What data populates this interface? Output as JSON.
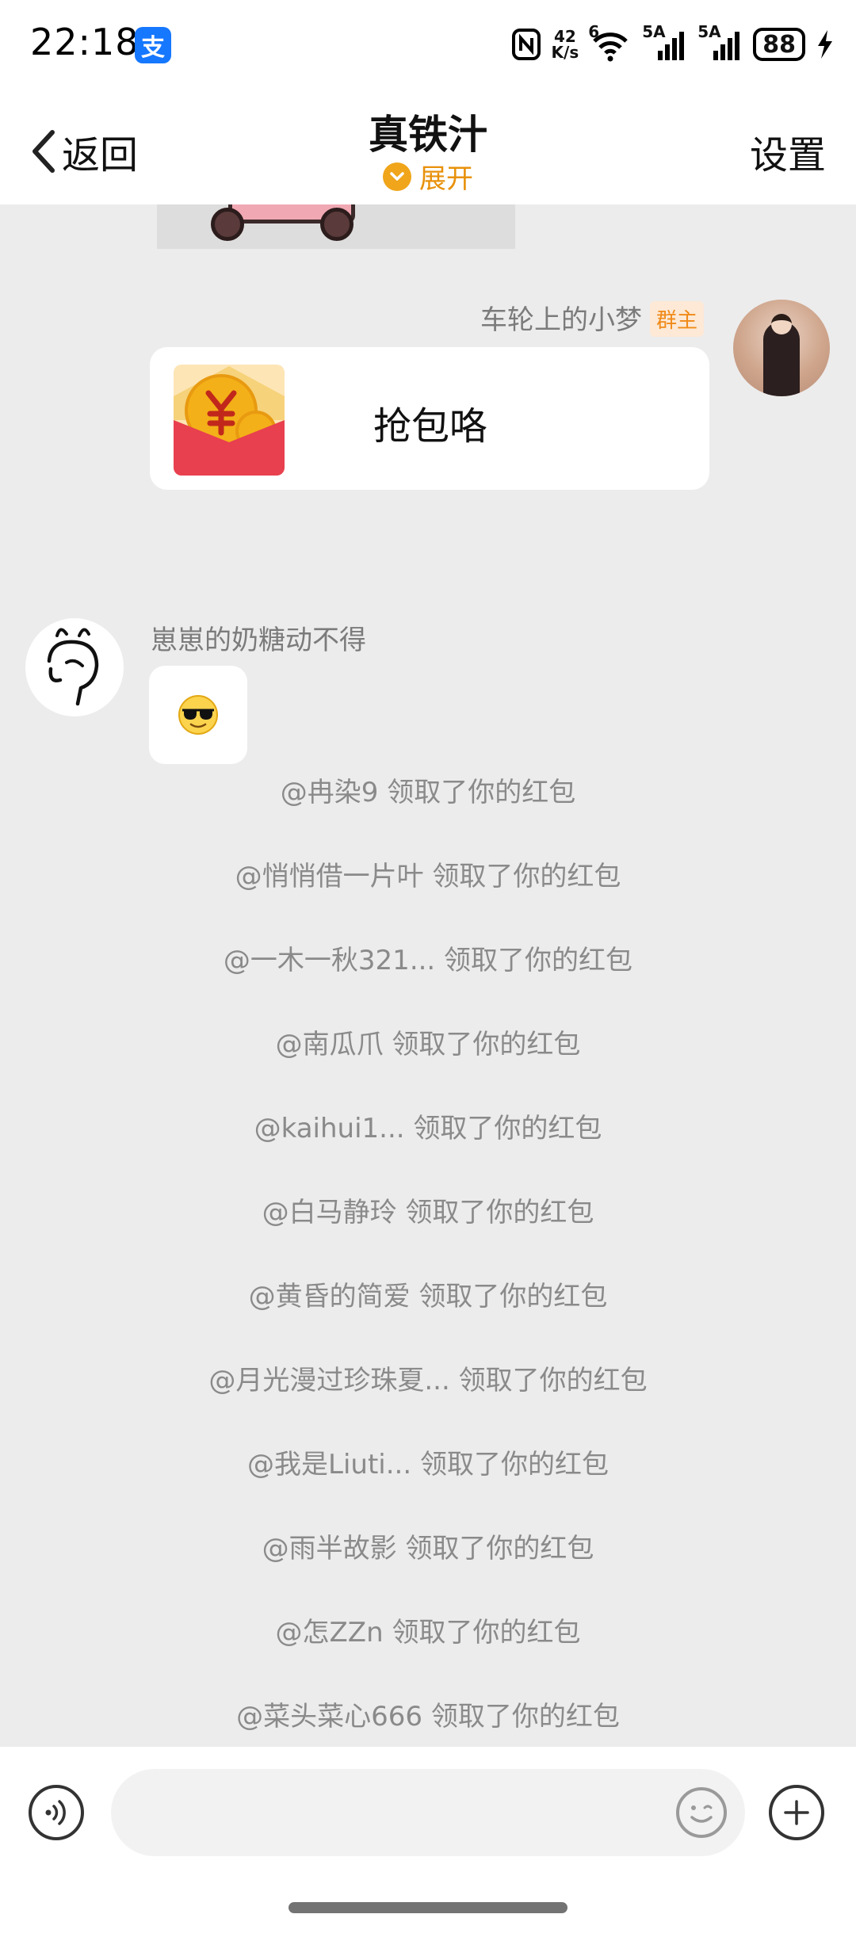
{
  "status_bar": {
    "time": "22:18",
    "app_badge": "支",
    "net_speed_value": "42",
    "net_speed_unit": "K/s",
    "wifi_label": "6",
    "signal1_label": "5A",
    "signal2_label": "5A",
    "battery": "88"
  },
  "nav": {
    "back_label": "返回",
    "title": "真铁汁",
    "expand_label": "展开",
    "settings_label": "设置"
  },
  "messages": {
    "red_packet": {
      "sender": "车轮上的小梦",
      "sender_badge": "群主",
      "text": "抢包咯"
    },
    "emoji_message": {
      "sender": "崽崽的奶糖动不得",
      "emoji": "😎"
    }
  },
  "notices": [
    "@冉染9 领取了你的红包",
    "@悄悄借一片叶 领取了你的红包",
    "@一木一秋321... 领取了你的红包",
    "@南瓜爪 领取了你的红包",
    "@kaihui1... 领取了你的红包",
    "@白马静玲 领取了你的红包",
    "@黄昏的简爱 领取了你的红包",
    "@月光漫过珍珠夏... 领取了你的红包",
    "@我是Liuti... 领取了你的红包",
    "@雨半故影 领取了你的红包",
    "@怎ZZn 领取了你的红包",
    "@菜头菜心666 领取了你的红包"
  ],
  "input": {
    "placeholder": ""
  },
  "colors": {
    "accent_orange": "#f0a51a",
    "red_packet": "#e8404f",
    "chat_bg": "#ececec"
  }
}
